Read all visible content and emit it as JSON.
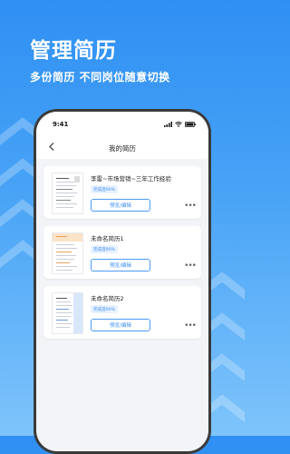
{
  "promo": {
    "title": "管理简历",
    "subtitle": "多份简历 不同岗位随意切换"
  },
  "status_bar": {
    "time": "9:41"
  },
  "nav": {
    "back_icon": "chevron-left-icon",
    "title": "我的简历"
  },
  "resumes": [
    {
      "title": "李雷~市场营销~三年工作经验",
      "completeness": "完成度90%",
      "action": "预览/编辑",
      "thumb_style": "plain"
    },
    {
      "title": "未命名简历1",
      "completeness": "完成度90%",
      "action": "预览/编辑",
      "thumb_style": "orange"
    },
    {
      "title": "未命名简历2",
      "completeness": "完成度90%",
      "action": "预览/编辑",
      "thumb_style": "blue"
    }
  ],
  "colors": {
    "background_top": "#2f8ff3",
    "background_bottom": "#7ec4fb",
    "accent": "#3b8ff5",
    "badge_bg": "#e8f2ff"
  }
}
